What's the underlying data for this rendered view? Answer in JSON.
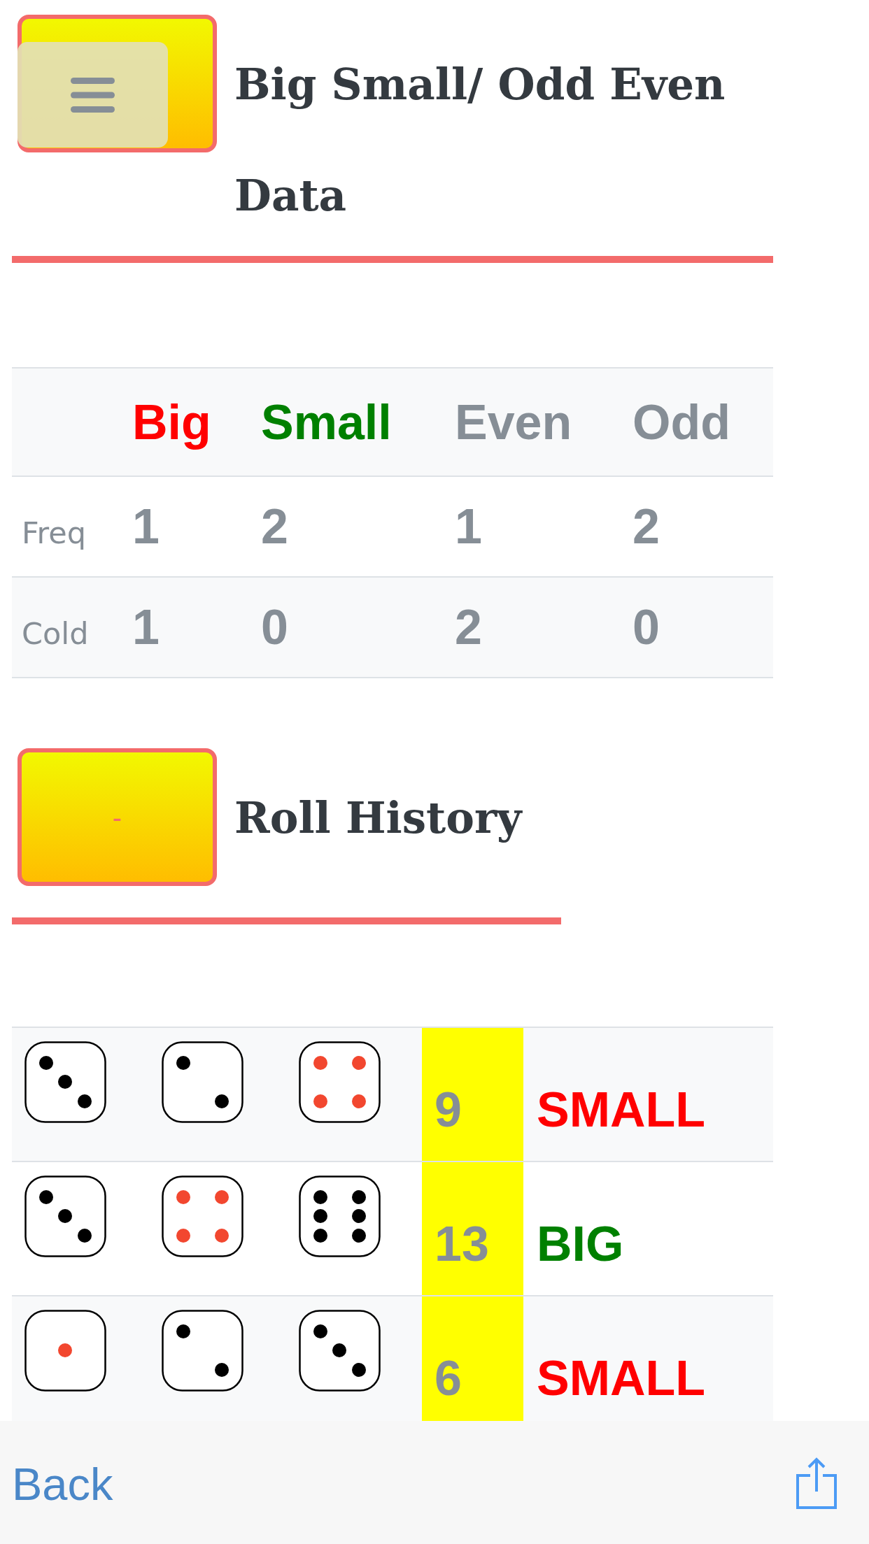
{
  "stats_section": {
    "title": "Big Small/ Odd Even Data",
    "table": {
      "columns": [
        {
          "label": "Big",
          "color": "#ff0000"
        },
        {
          "label": "Small",
          "color": "#008000"
        },
        {
          "label": "Even",
          "color": "#868e96"
        },
        {
          "label": "Odd",
          "color": "#868e96"
        }
      ],
      "rows": [
        {
          "label": "Freq",
          "values": [
            "1",
            "2",
            "1",
            "2"
          ]
        },
        {
          "label": "Cold",
          "values": [
            "1",
            "0",
            "2",
            "0"
          ]
        }
      ]
    }
  },
  "history_section": {
    "toggle_label": "-",
    "title": "Roll History",
    "rows": [
      {
        "dice": [
          {
            "kind": "three"
          },
          {
            "kind": "two"
          },
          {
            "kind": "four"
          }
        ],
        "sum": "9",
        "result": "SMALL",
        "color": "#ff0000"
      },
      {
        "dice": [
          {
            "kind": "three"
          },
          {
            "kind": "four"
          },
          {
            "kind": "six"
          }
        ],
        "sum": "13",
        "result": "BIG",
        "color": "#008000"
      },
      {
        "dice": [
          {
            "kind": "one"
          },
          {
            "kind": "two"
          },
          {
            "kind": "three"
          }
        ],
        "sum": "6",
        "result": "SMALL",
        "color": "#ff0000"
      }
    ]
  },
  "toolbar": {
    "back": "Back"
  }
}
